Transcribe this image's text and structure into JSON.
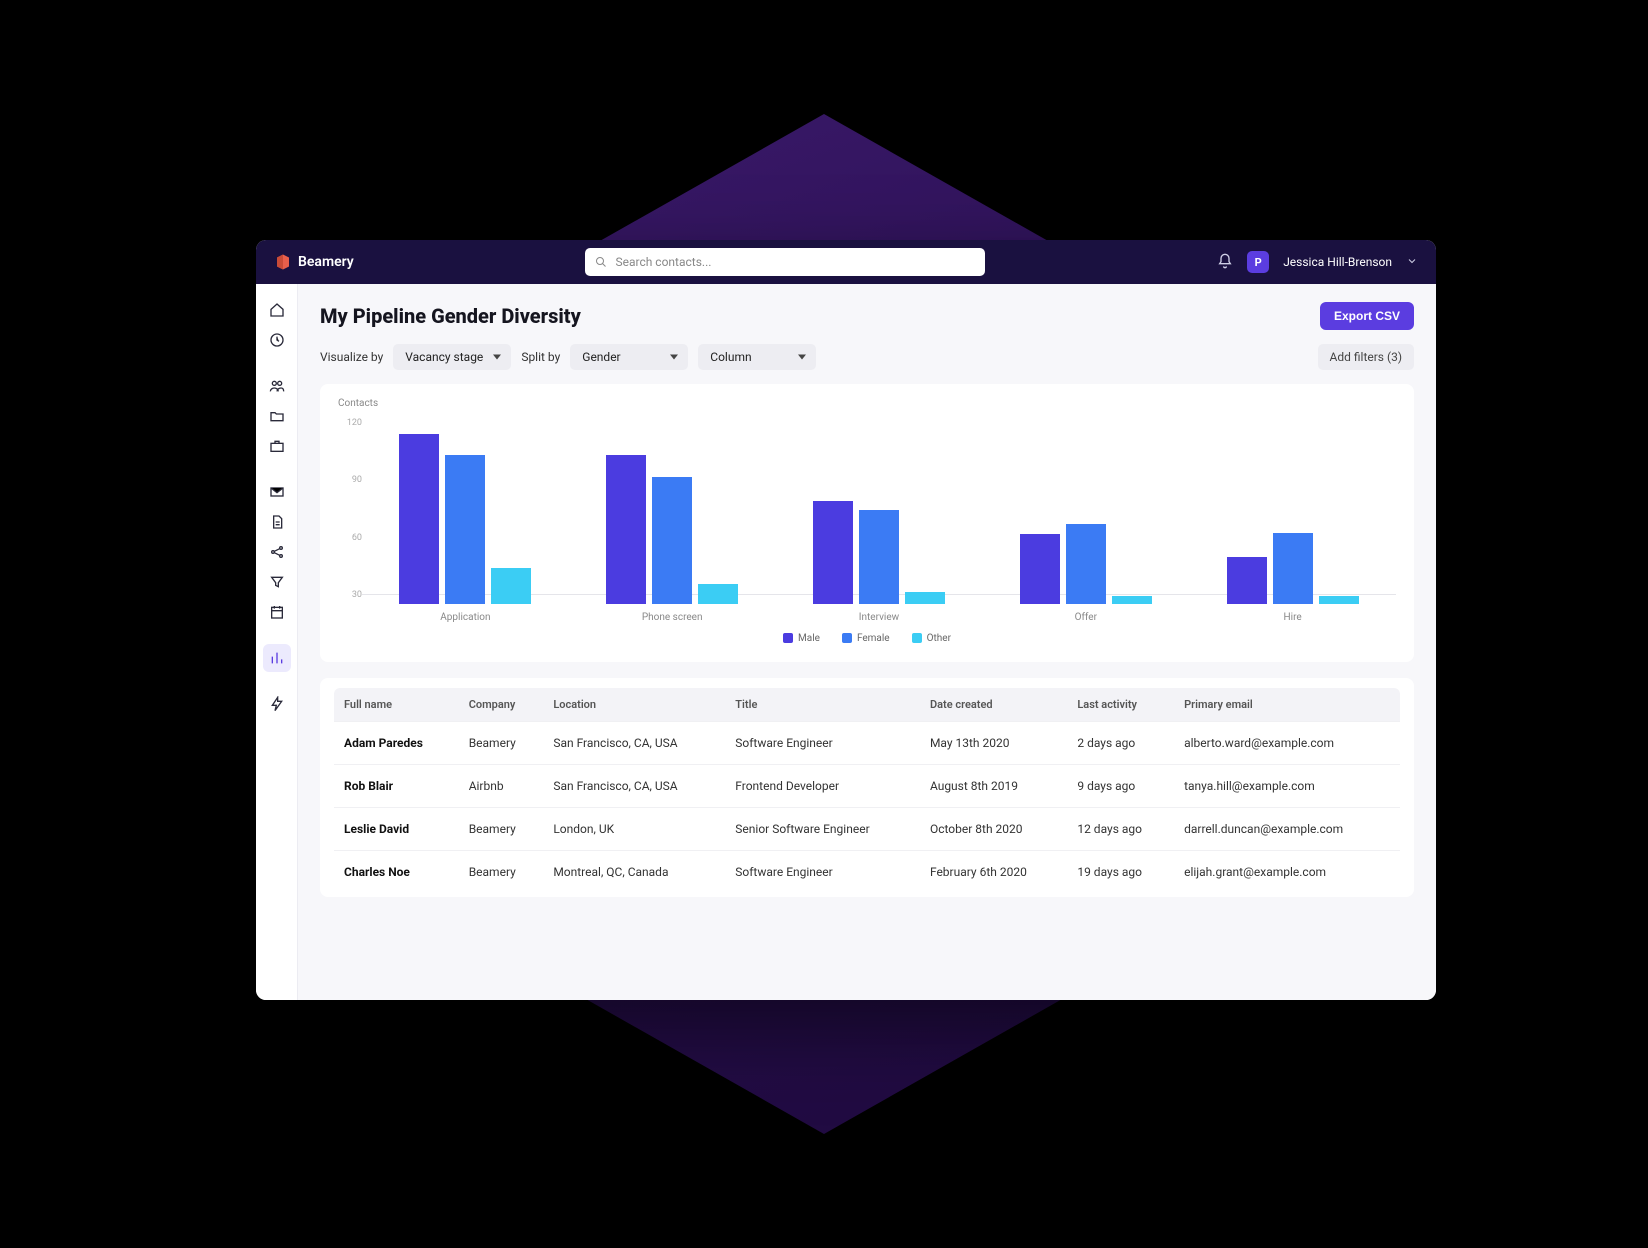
{
  "brand": "Beamery",
  "search": {
    "placeholder": "Search contacts..."
  },
  "user": {
    "initial": "P",
    "name": "Jessica Hill-Brenson"
  },
  "page": {
    "title": "My Pipeline Gender Diversity",
    "export_label": "Export CSV",
    "visualize_label": "Visualize by",
    "visualize_value": "Vacancy stage",
    "split_label": "Split by",
    "split_value": "Gender",
    "layout_value": "Column",
    "filters_label": "Add filters (3)"
  },
  "chart": {
    "y_title": "Contacts",
    "y_ticks": [
      "120",
      "90",
      "60",
      "30"
    ],
    "categories": [
      "Application",
      "Phone screen",
      "Interview",
      "Offer",
      "Hire"
    ],
    "legend": [
      "Male",
      "Female",
      "Other"
    ],
    "colors": [
      "#4b3ce0",
      "#3b7bf4",
      "#3bcdf4"
    ]
  },
  "chart_data": {
    "type": "bar",
    "title": "My Pipeline Gender Diversity",
    "xlabel": "Vacancy stage",
    "ylabel": "Contacts",
    "ylim": [
      0,
      120
    ],
    "categories": [
      "Application",
      "Phone screen",
      "Interview",
      "Offer",
      "Hire"
    ],
    "series": [
      {
        "name": "Male",
        "values": [
          112,
          98,
          68,
          46,
          31
        ]
      },
      {
        "name": "Female",
        "values": [
          98,
          84,
          62,
          53,
          47
        ]
      },
      {
        "name": "Other",
        "values": [
          24,
          13,
          8,
          5,
          5
        ]
      }
    ]
  },
  "table": {
    "columns": [
      "Full name",
      "Company",
      "Location",
      "Title",
      "Date created",
      "Last activity",
      "Primary email"
    ],
    "rows": [
      {
        "name": "Adam Paredes",
        "company": "Beamery",
        "location": "San Francisco, CA, USA",
        "title": "Software Engineer",
        "created": "May 13th 2020",
        "activity": "2 days ago",
        "email": "alberto.ward@example.com"
      },
      {
        "name": "Rob Blair",
        "company": "Airbnb",
        "location": "San Francisco, CA, USA",
        "title": "Frontend Developer",
        "created": "August 8th 2019",
        "activity": "9 days ago",
        "email": "tanya.hill@example.com"
      },
      {
        "name": "Leslie David",
        "company": "Beamery",
        "location": "London, UK",
        "title": "Senior Software Engineer",
        "created": "October 8th 2020",
        "activity": "12 days ago",
        "email": "darrell.duncan@example.com"
      },
      {
        "name": "Charles Noe",
        "company": "Beamery",
        "location": "Montreal, QC, Canada",
        "title": "Software Engineer",
        "created": "February 6th 2020",
        "activity": "19 days ago",
        "email": "elijah.grant@example.com"
      }
    ]
  }
}
